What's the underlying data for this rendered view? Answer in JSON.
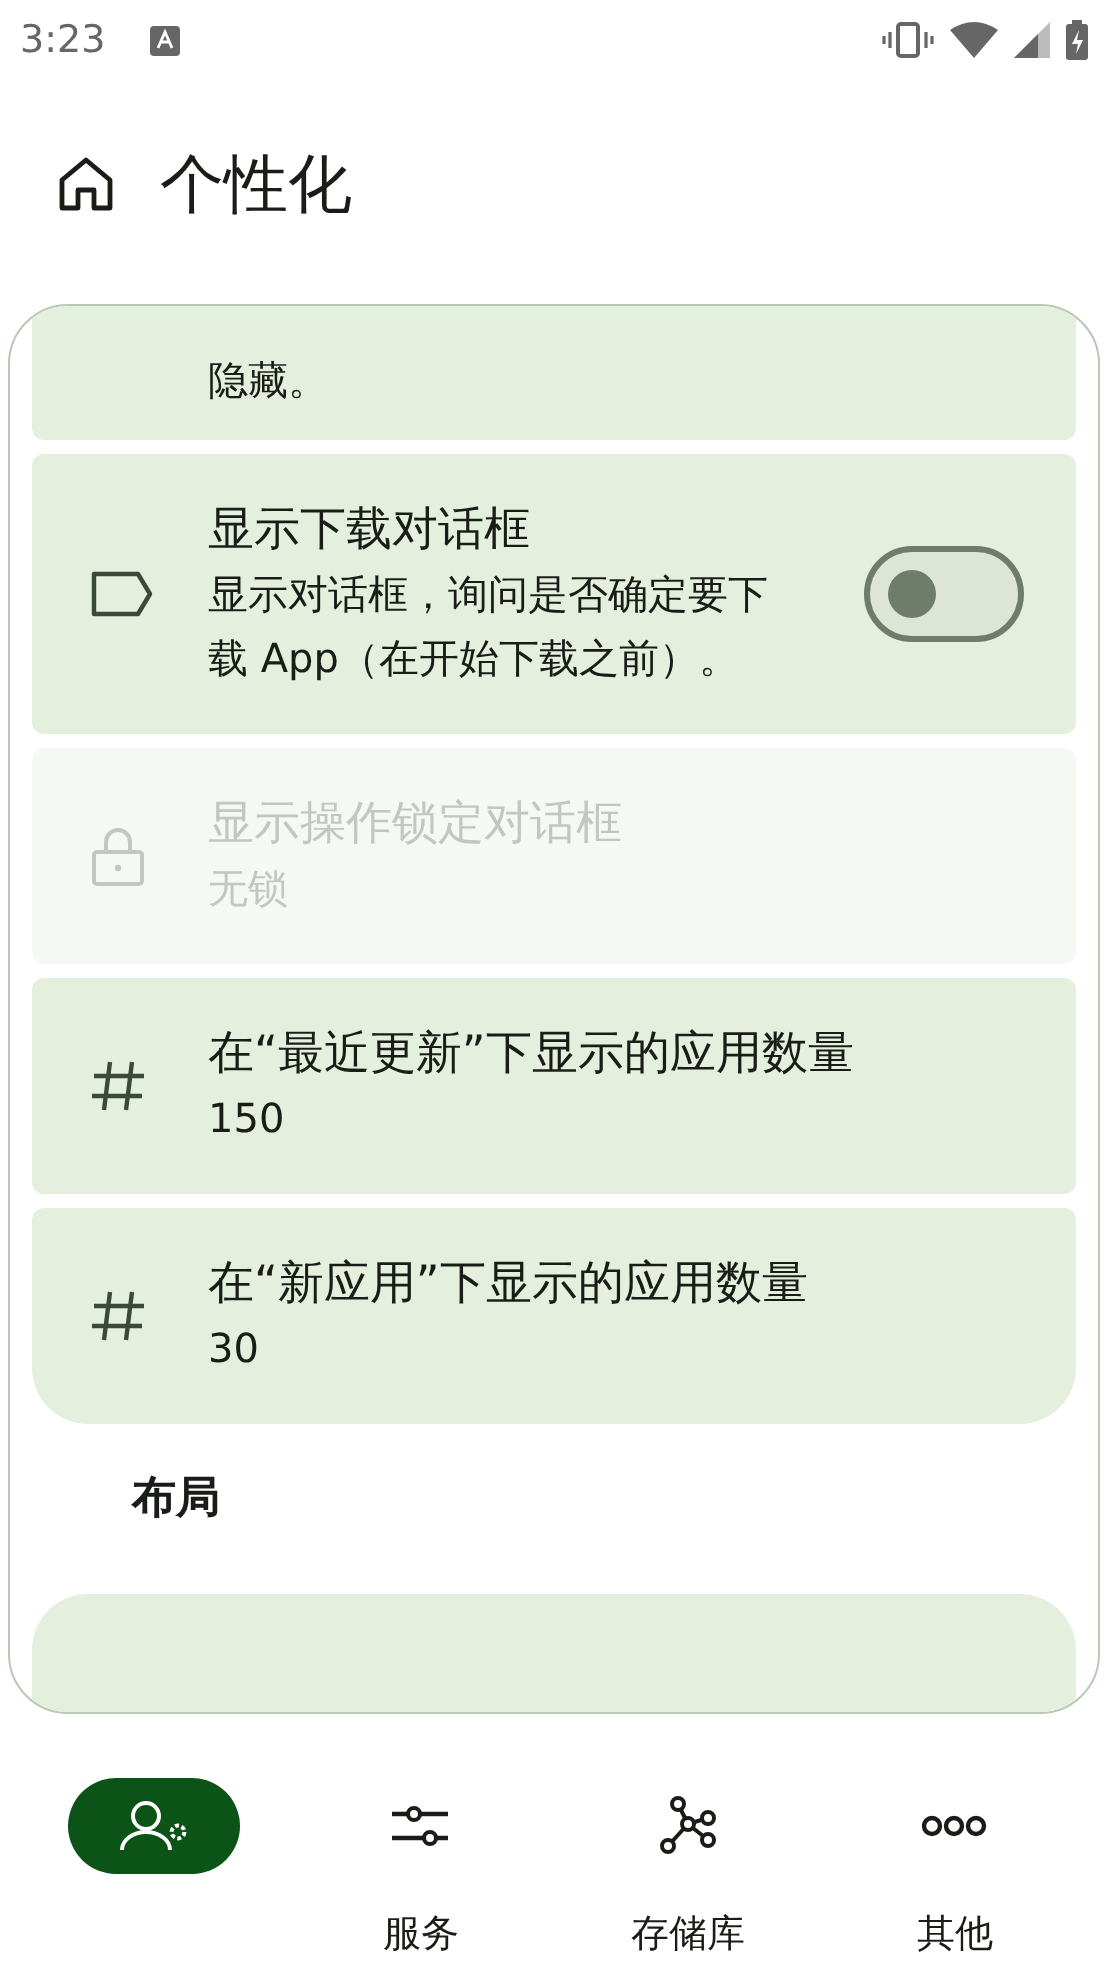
{
  "status_bar": {
    "time": "3:23"
  },
  "header": {
    "title": "个性化"
  },
  "items": [
    {
      "kind": "text",
      "description": "隐藏。",
      "disabled": false
    },
    {
      "kind": "switch",
      "title": "显示下载对话框",
      "description": "显示对话框，询问是否确定要下载 App（在开始下载之前）。",
      "on": false,
      "disabled": false
    },
    {
      "kind": "text",
      "title": "显示操作锁定对话框",
      "description": "无锁",
      "disabled": true
    },
    {
      "kind": "text",
      "title": "在“最近更新”下显示的应用数量",
      "description": "150",
      "disabled": false
    },
    {
      "kind": "text",
      "title": "在“新应用”下显示的应用数量",
      "description": "30",
      "disabled": false
    }
  ],
  "section": {
    "title": "布局"
  },
  "nav": [
    {
      "selected": true
    },
    {
      "label": "服务",
      "selected": false
    },
    {
      "label": "存储库",
      "selected": false
    },
    {
      "label": "其他",
      "selected": false
    }
  ]
}
